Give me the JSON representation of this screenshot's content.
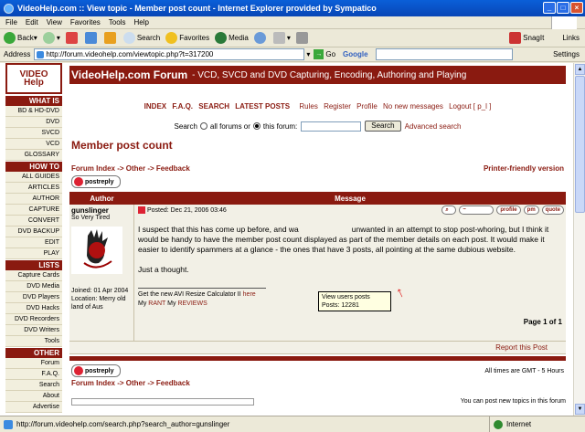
{
  "window": {
    "title": "VideoHelp.com :: View topic - Member post count - Internet Explorer provided by Sympatico",
    "min": "_",
    "max": "□",
    "close": "×"
  },
  "menu": [
    "File",
    "Edit",
    "View",
    "Favorites",
    "Tools",
    "Help"
  ],
  "toolbar": {
    "back": "Back",
    "search": "Search",
    "favorites": "Favorites",
    "media": "Media",
    "snagit": "SnagIt",
    "links": "Links"
  },
  "address": {
    "label": "Address",
    "url": "http://forum.videohelp.com/viewtopic.php?t=317200",
    "go": "Go",
    "google": "Google",
    "settings": "Settings"
  },
  "sidebar": {
    "logo_top": "VIDEO",
    "logo_bottom": "Help",
    "sections": [
      {
        "head": "WHAT IS",
        "items": [
          "BD & HD-DVD",
          "DVD",
          "SVCD",
          "VCD",
          "GLOSSARY"
        ]
      },
      {
        "head": "HOW TO",
        "items": [
          "ALL GUIDES",
          "ARTICLES",
          "AUTHOR",
          "CAPTURE",
          "CONVERT",
          "DVD BACKUP",
          "EDIT",
          "PLAY"
        ]
      },
      {
        "head": "LISTS",
        "items": [
          "Capture Cards",
          "DVD Media",
          "DVD Players",
          "DVD Hacks",
          "DVD Recorders",
          "DVD Writers",
          "Tools"
        ]
      },
      {
        "head": "OTHER",
        "items": [
          "Forum",
          "F.A.Q.",
          "Search",
          "About",
          "Advertise"
        ]
      }
    ]
  },
  "header": {
    "site": "VideoHelp.com Forum",
    "tagline": "- VCD, SVCD and DVD Capturing, Encoding, Authoring and Playing"
  },
  "nav": {
    "big": [
      "INDEX",
      "F.A.Q.",
      "SEARCH",
      "LATEST POSTS"
    ],
    "small": [
      "Rules",
      "Register",
      "Profile",
      "No new messages",
      "Logout [ p_l ]"
    ]
  },
  "search": {
    "label": "Search",
    "opt_all": "all forums or",
    "opt_this": "this forum:",
    "button": "Search",
    "advanced": "Advanced search"
  },
  "page": {
    "title": "Member post count",
    "breadcrumb": "Forum Index -> Other -> Feedback",
    "printer": "Printer-friendly version",
    "postreply": "postreply"
  },
  "table": {
    "author_head": "Author",
    "message_head": "Message"
  },
  "post": {
    "username": "gunslinger",
    "rank": "So Very Tired",
    "joined": "Joined: 01 Apr 2004",
    "location": "Location: Merry old land of Aus",
    "posted": "Posted: Dec 21, 2006 03:46",
    "buttons": [
      "profile",
      "pm",
      "quote"
    ],
    "text1_a": "I suspect that this has come up before, and wa",
    "text1_b": "unwanted in an attempt to stop post-whoring, but I think it would be handy to have the member post count displayed as part of the member details on each post. It would make it easier to identify spammers at a glance - the ones that have 3 posts, all pointing at the same dubious website.",
    "text2": "Just a thought.",
    "sig1_text": "Get the new AVI Resize Calculator II ",
    "sig1_link": "here",
    "sig2_a": "My ",
    "sig2_link1": "RANT",
    "sig2_b": " My ",
    "sig2_link2": "REVIEWS",
    "page_of": "Page 1 of 1",
    "report": "Report this Post"
  },
  "tooltip": {
    "line1": "View users posts",
    "line2": "Posts: 12281"
  },
  "footer": {
    "timezone": "All times are GMT - 5 Hours",
    "can_post": "You can post new topics in this forum"
  },
  "status": {
    "url": "http://forum.videohelp.com/search.php?search_author=gunslinger",
    "zone": "Internet"
  }
}
